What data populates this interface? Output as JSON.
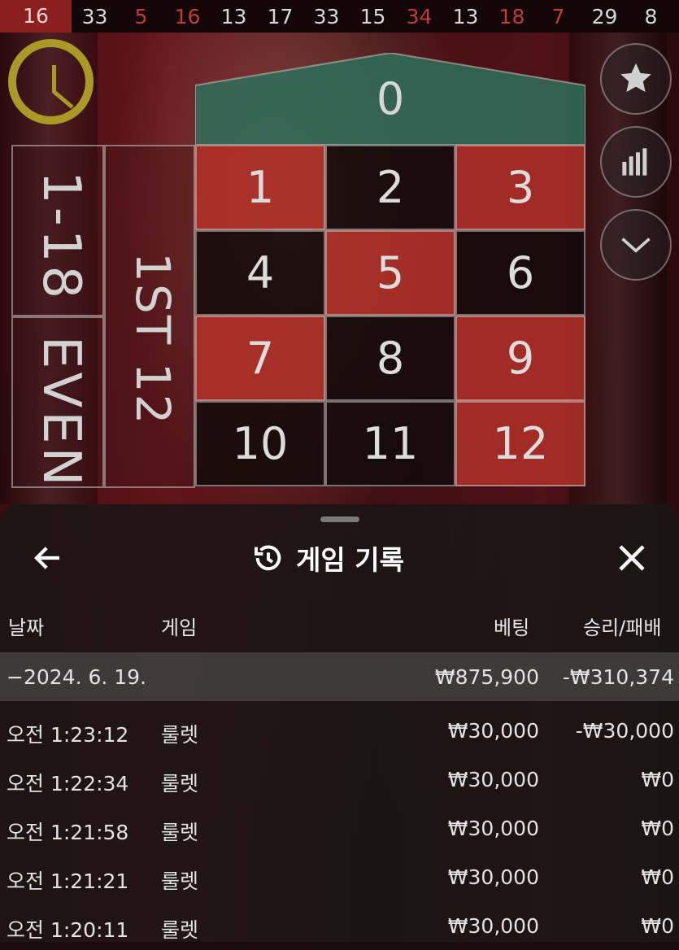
{
  "history": {
    "numbers": [
      {
        "n": "16",
        "color": "active"
      },
      {
        "n": "33",
        "color": "black"
      },
      {
        "n": "5",
        "color": "red"
      },
      {
        "n": "16",
        "color": "red"
      },
      {
        "n": "13",
        "color": "black"
      },
      {
        "n": "17",
        "color": "black"
      },
      {
        "n": "33",
        "color": "black"
      },
      {
        "n": "15",
        "color": "black"
      },
      {
        "n": "34",
        "color": "red"
      },
      {
        "n": "13",
        "color": "black"
      },
      {
        "n": "18",
        "color": "red"
      },
      {
        "n": "7",
        "color": "red"
      },
      {
        "n": "29",
        "color": "black"
      },
      {
        "n": "8",
        "color": "black"
      }
    ]
  },
  "table": {
    "zero": "0",
    "cells": [
      {
        "n": "1",
        "color": "red"
      },
      {
        "n": "2",
        "color": "black"
      },
      {
        "n": "3",
        "color": "red"
      },
      {
        "n": "4",
        "color": "black"
      },
      {
        "n": "5",
        "color": "red"
      },
      {
        "n": "6",
        "color": "black"
      },
      {
        "n": "7",
        "color": "red"
      },
      {
        "n": "8",
        "color": "black"
      },
      {
        "n": "9",
        "color": "red"
      },
      {
        "n": "10",
        "color": "black"
      },
      {
        "n": "11",
        "color": "black"
      },
      {
        "n": "12",
        "color": "red"
      }
    ],
    "low_label": "1-18",
    "even_label": "EVEN",
    "dozen_label": "1ST 12"
  },
  "panel": {
    "title": "게임 기록",
    "columns": {
      "date": "날짜",
      "game": "게임",
      "bet": "베팅",
      "result": "승리/패배"
    },
    "summary": {
      "date": "−2024. 6. 19.",
      "bet": "₩875,900",
      "result": "-₩310,374"
    },
    "rows": [
      {
        "time": "오전 1:23:12",
        "game": "룰렛",
        "bet": "₩30,000",
        "result": "-₩30,000"
      },
      {
        "time": "오전 1:22:34",
        "game": "룰렛",
        "bet": "₩30,000",
        "result": "₩0"
      },
      {
        "time": "오전 1:21:58",
        "game": "룰렛",
        "bet": "₩30,000",
        "result": "₩0"
      },
      {
        "time": "오전 1:21:21",
        "game": "룰렛",
        "bet": "₩30,000",
        "result": "₩0"
      },
      {
        "time": "오전 1:20:11",
        "game": "룰렛",
        "bet": "₩30,000",
        "result": "₩0"
      }
    ]
  },
  "icons": {
    "timer": "timer-icon",
    "favorite": "star-icon",
    "stats": "stats-icon",
    "collapse": "chevron-down-icon",
    "back": "arrow-left-icon",
    "history": "history-icon",
    "close": "close-icon"
  },
  "colors": {
    "red": "#b23028",
    "black": "#120a0a",
    "zero": "#2e6f5c",
    "timer": "#a99a25"
  }
}
